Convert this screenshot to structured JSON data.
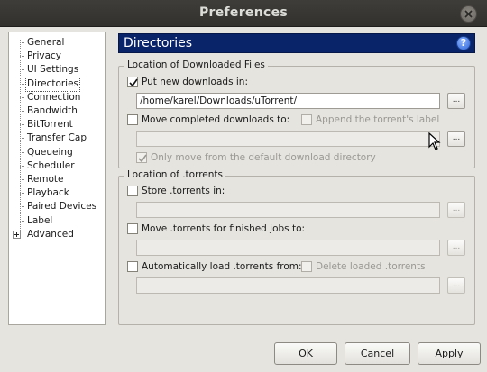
{
  "window": {
    "title": "Preferences"
  },
  "sidebar": {
    "items": [
      {
        "label": "General"
      },
      {
        "label": "Privacy"
      },
      {
        "label": "UI Settings"
      },
      {
        "label": "Directories",
        "selected": true
      },
      {
        "label": "Connection"
      },
      {
        "label": "Bandwidth"
      },
      {
        "label": "BitTorrent"
      },
      {
        "label": "Transfer Cap"
      },
      {
        "label": "Queueing"
      },
      {
        "label": "Scheduler"
      },
      {
        "label": "Remote"
      },
      {
        "label": "Playback"
      },
      {
        "label": "Paired Devices"
      },
      {
        "label": "Label"
      },
      {
        "label": "Advanced",
        "expandable": true
      }
    ]
  },
  "page": {
    "title": "Directories"
  },
  "downloaded": {
    "group_title": "Location of Downloaded Files",
    "put_new": {
      "label": "Put new downloads in:",
      "checked": true,
      "path": "/home/karel/Downloads/uTorrent/"
    },
    "move_completed": {
      "label": "Move completed downloads to:",
      "checked": false,
      "path": ""
    },
    "append_label": {
      "label": "Append the torrent's label",
      "checked": false,
      "enabled": false
    },
    "only_move_default": {
      "label": "Only move from the default download directory",
      "checked": true,
      "enabled": false
    }
  },
  "torrents": {
    "group_title": "Location of .torrents",
    "store": {
      "label": "Store .torrents in:",
      "checked": false,
      "path": ""
    },
    "move_finished": {
      "label": "Move .torrents for finished jobs to:",
      "checked": false,
      "path": ""
    },
    "auto_load": {
      "label": "Automatically load .torrents from:",
      "checked": false,
      "path": ""
    },
    "delete_loaded": {
      "label": "Delete loaded .torrents",
      "checked": false,
      "enabled": false
    }
  },
  "browse_label": "...",
  "buttons": {
    "ok": "OK",
    "cancel": "Cancel",
    "apply": "Apply"
  },
  "colors": {
    "header_bg": "#0a246a",
    "window_bg": "#e6e4df",
    "titlebar_bg": "#3a3835"
  }
}
